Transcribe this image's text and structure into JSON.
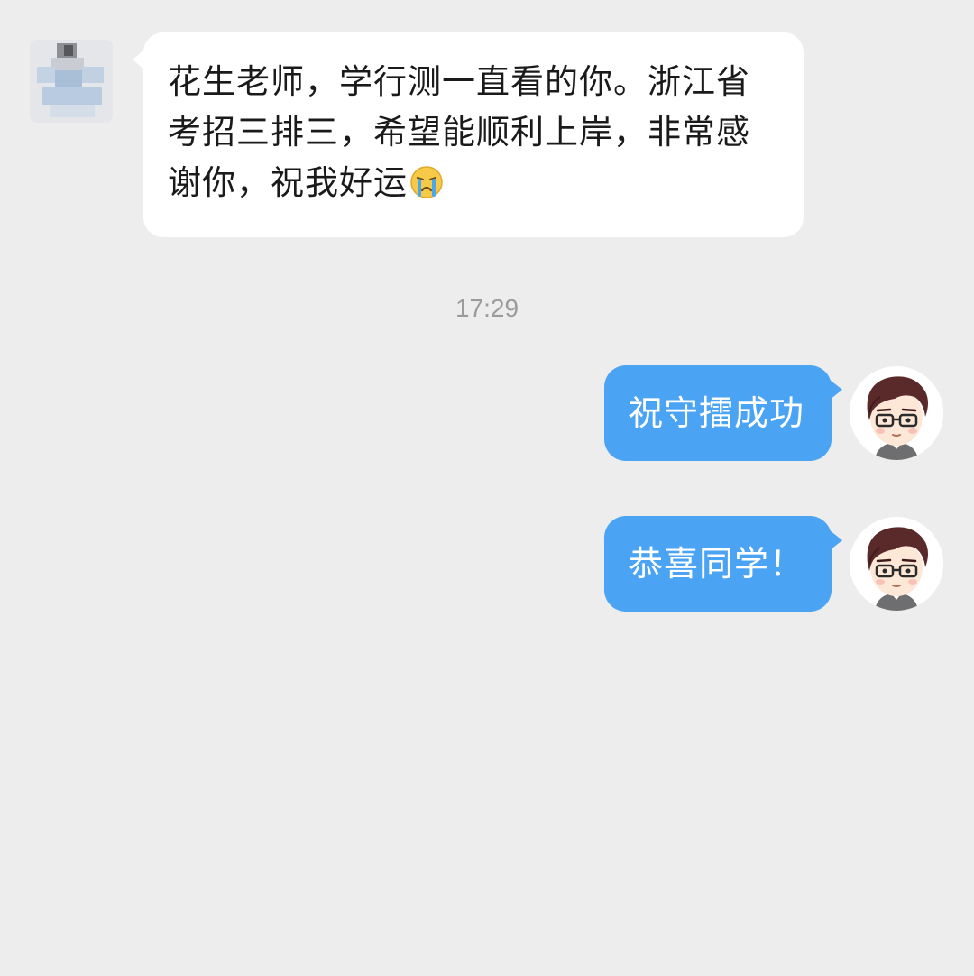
{
  "chat": {
    "incoming": {
      "sender_avatar": "blurred-avatar-icon",
      "text": "花生老师，学行测一直看的你。浙江省考招三排三，希望能顺利上岸，非常感谢你，祝我好运",
      "emoji": "crying-face-icon"
    },
    "timestamp": "17:29",
    "outgoing": [
      {
        "text": "祝守擂成功",
        "avatar": "cartoon-teacher-avatar-icon"
      },
      {
        "text": "恭喜同学！",
        "avatar": "cartoon-teacher-avatar-icon"
      }
    ]
  },
  "colors": {
    "background": "#ededed",
    "incoming_bubble": "#ffffff",
    "outgoing_bubble": "#4aa3f3",
    "timestamp_text": "#9b9b9b"
  }
}
